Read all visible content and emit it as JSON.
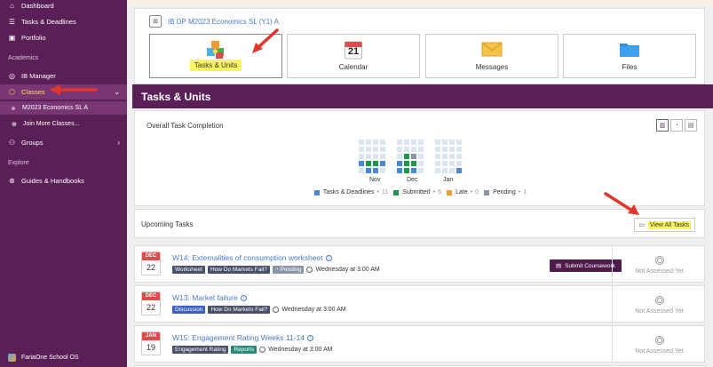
{
  "sidebar": {
    "items": [
      {
        "label": "Dashboard",
        "icon": "home-icon"
      },
      {
        "label": "Tasks & Deadlines",
        "icon": "checklist-icon"
      },
      {
        "label": "Portfolio",
        "icon": "portfolio-icon"
      }
    ],
    "section_academics": "Academics",
    "ib_manager": "IB Manager",
    "classes": "Classes",
    "class_selected": "M2023 Economics SL A",
    "join_more": "Join More Classes...",
    "groups": "Groups",
    "section_explore": "Explore",
    "guides": "Guides & Handbooks",
    "footer": "FariaOne School OS"
  },
  "header": {
    "class_name": "IB DP M2023 Economics SL (Y1) A",
    "tiles": [
      {
        "label": "Tasks & Units",
        "icon": "puzzle-icon"
      },
      {
        "label": "Calendar",
        "icon": "calendar-icon",
        "day": "21"
      },
      {
        "label": "Messages",
        "icon": "envelope-icon"
      },
      {
        "label": "Files",
        "icon": "folder-icon"
      }
    ]
  },
  "section_title": "Tasks & Units",
  "completion": {
    "title": "Overall Task Completion",
    "months": [
      "Nov",
      "Dec",
      "Jan"
    ],
    "legend": [
      {
        "label": "Tasks & Deadlines",
        "count": "11",
        "color": "#4a87d8"
      },
      {
        "label": "Submitted",
        "count": "6",
        "color": "#1a9a48"
      },
      {
        "label": "Late",
        "count": "0",
        "color": "#f39c30"
      },
      {
        "label": "Pending",
        "count": "1",
        "color": "#8c93a8"
      }
    ]
  },
  "chart_data": {
    "type": "heatmap",
    "title": "Overall Task Completion",
    "x_labels": [
      "Nov",
      "Dec",
      "Jan"
    ],
    "series": [
      {
        "name": "Tasks & Deadlines",
        "value": 11
      },
      {
        "name": "Submitted",
        "value": 6
      },
      {
        "name": "Late",
        "value": 0
      },
      {
        "name": "Pending",
        "value": 1
      }
    ]
  },
  "upcoming": {
    "title": "Upcoming Tasks",
    "view_all": "View All Tasks"
  },
  "tasks": [
    {
      "month": "DEC",
      "day": "22",
      "title": "W14: Externalities of consumption worksheet",
      "tags": [
        {
          "label": "Worksheet",
          "color": "#4a4f6a"
        },
        {
          "label": "How Do Markets Fail?",
          "color": "#4a4f6a"
        },
        {
          "label": "Pending",
          "color": "#8c93a8"
        }
      ],
      "due": "Wednesday at 3:00 AM",
      "action": "Submit Coursework",
      "status": "Not Assessed Yet"
    },
    {
      "month": "DEC",
      "day": "22",
      "title": "W13: Market failure",
      "tags": [
        {
          "label": "Discussion",
          "color": "#3d5fc0"
        },
        {
          "label": "How Do Markets Fail?",
          "color": "#4a4f6a"
        }
      ],
      "due": "Wednesday at 3:00 AM",
      "status": "Not Assessed Yet"
    },
    {
      "month": "JAN",
      "day": "19",
      "title": "W15: Engagement Rating Weeks 11-14",
      "tags": [
        {
          "label": "Engagement Rating",
          "color": "#4a4f6a"
        },
        {
          "label": "Reports",
          "color": "#2a8a7a"
        }
      ],
      "due": "Wednesday at 3:00 AM",
      "status": "Not Assessed Yet"
    }
  ]
}
